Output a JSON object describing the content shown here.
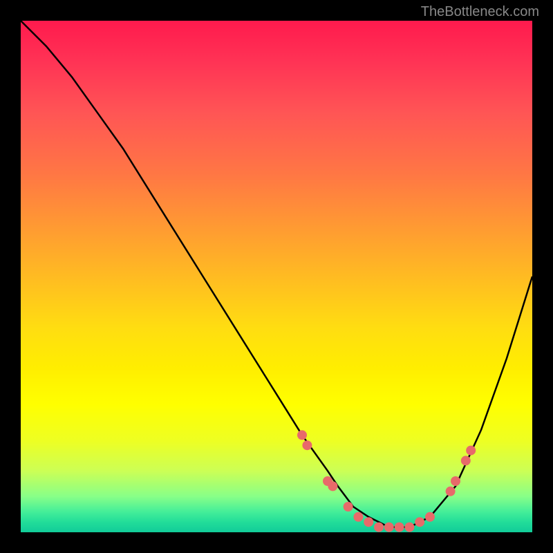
{
  "watermark": "TheBottleneck.com",
  "chart_data": {
    "type": "line",
    "title": "",
    "xlabel": "",
    "ylabel": "",
    "xlim": [
      0,
      100
    ],
    "ylim": [
      0,
      100
    ],
    "series": [
      {
        "name": "curve",
        "x": [
          0,
          5,
          10,
          15,
          20,
          25,
          30,
          35,
          40,
          45,
          50,
          55,
          60,
          62,
          65,
          68,
          72,
          76,
          80,
          85,
          90,
          95,
          100
        ],
        "y": [
          100,
          95,
          89,
          82,
          75,
          67,
          59,
          51,
          43,
          35,
          27,
          19,
          12,
          9,
          5,
          3,
          1,
          1,
          3,
          9,
          20,
          34,
          50
        ]
      }
    ],
    "markers": [
      {
        "x": 55,
        "y": 19
      },
      {
        "x": 56,
        "y": 17
      },
      {
        "x": 60,
        "y": 10
      },
      {
        "x": 61,
        "y": 9
      },
      {
        "x": 64,
        "y": 5
      },
      {
        "x": 66,
        "y": 3
      },
      {
        "x": 68,
        "y": 2
      },
      {
        "x": 70,
        "y": 1
      },
      {
        "x": 72,
        "y": 1
      },
      {
        "x": 74,
        "y": 1
      },
      {
        "x": 76,
        "y": 1
      },
      {
        "x": 78,
        "y": 2
      },
      {
        "x": 80,
        "y": 3
      },
      {
        "x": 84,
        "y": 8
      },
      {
        "x": 85,
        "y": 10
      },
      {
        "x": 87,
        "y": 14
      },
      {
        "x": 88,
        "y": 16
      }
    ],
    "colors": {
      "curve": "#000000",
      "marker": "#e86a6a"
    }
  }
}
